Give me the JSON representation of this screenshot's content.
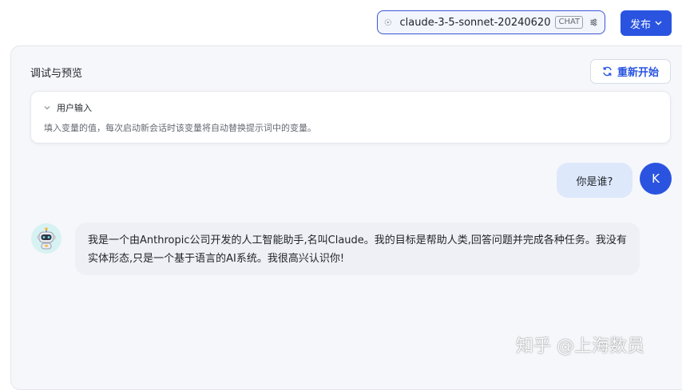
{
  "header": {
    "model_name": "claude-3-5-sonnet-20240620",
    "model_badge": "CHAT",
    "publish_label": "发布"
  },
  "panel": {
    "title": "调试与预览",
    "restart_label": "重新开始",
    "user_input": {
      "title": "用户输入",
      "description": "填入变量的值，每次启动新会话时该变量将自动替换提示词中的变量。"
    }
  },
  "messages": {
    "user": {
      "avatar_letter": "K",
      "text": "你是谁?"
    },
    "assistant": {
      "text": "我是一个由Anthropic公司开发的人工智能助手,名叫Claude。我的目标是帮助人类,回答问题并完成各种任务。我没有实体形态,只是一个基于语言的AI系统。我很高兴认识你!"
    }
  },
  "watermark": "知乎 @上海数员",
  "colors": {
    "accent": "#2a54e0",
    "user_bubble": "#dde8fb",
    "bot_bubble": "#eef0f5"
  }
}
